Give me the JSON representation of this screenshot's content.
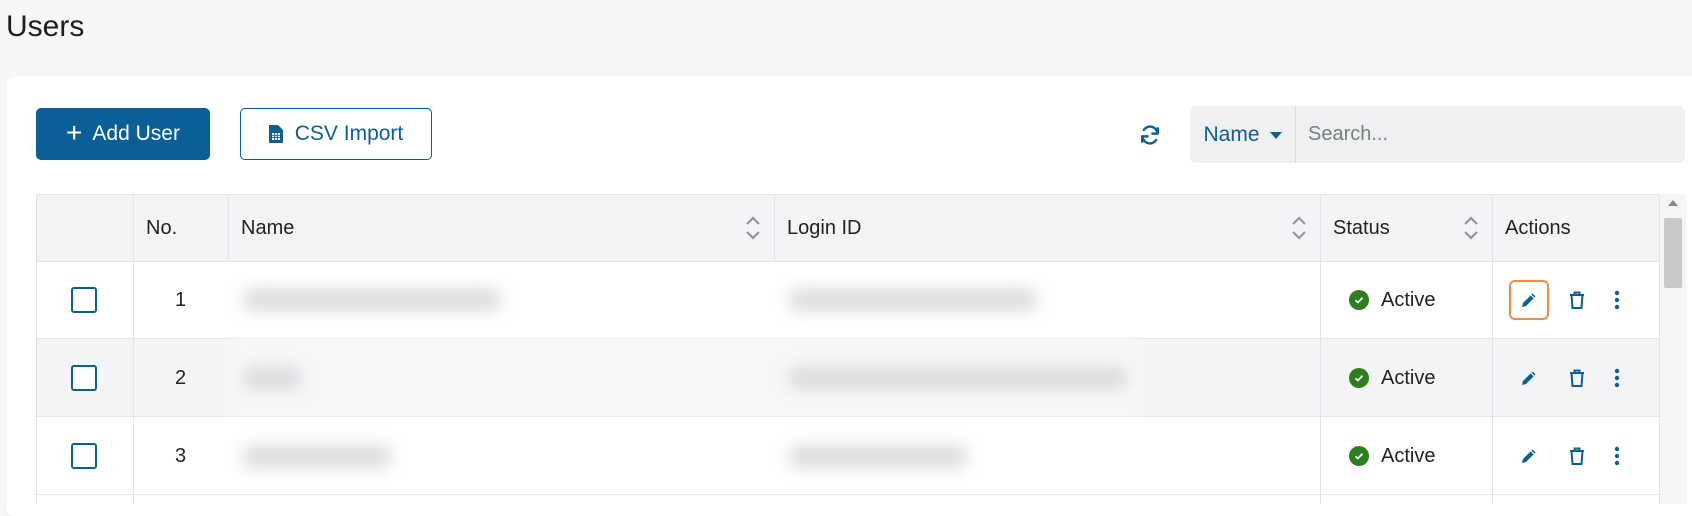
{
  "page": {
    "title": "Users"
  },
  "toolbar": {
    "add_label": "Add User",
    "import_label": "CSV Import",
    "search_field": "Name",
    "search_placeholder": "Search..."
  },
  "table": {
    "columns": {
      "no": "No.",
      "name": "Name",
      "login_id": "Login ID",
      "status": "Status",
      "actions": "Actions"
    },
    "rows": [
      {
        "no": "1",
        "status": "Active"
      },
      {
        "no": "2",
        "status": "Active"
      },
      {
        "no": "3",
        "status": "Active"
      }
    ]
  },
  "colors": {
    "primary": "#0b5e96",
    "status_active": "#2e7d1e",
    "focus_ring": "#f08c4a"
  },
  "icons": {
    "add": "plus-icon",
    "import": "csv-file-icon",
    "refresh": "refresh-icon",
    "field_dropdown": "caret-down-icon",
    "sort": "sort-icon",
    "status": "check-circle-icon",
    "edit": "pencil-icon",
    "delete": "trash-icon",
    "more": "kebab-menu-icon"
  }
}
